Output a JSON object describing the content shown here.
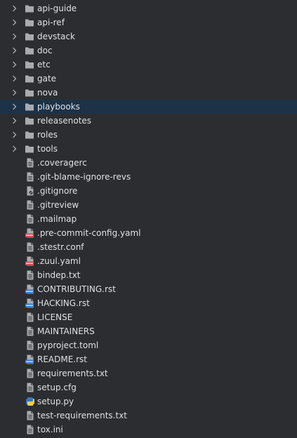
{
  "colors": {
    "background": "#2b2d30",
    "selection": "#1d3247",
    "text": "#dfe1e5",
    "icon": "#a9abaf",
    "yaml_badge": "#c94f4f",
    "rst_badge": "#3c7ac2",
    "python_blue": "#3b76b3",
    "python_yellow": "#f2cd4a"
  },
  "tree": {
    "folders": [
      {
        "label": "api-guide",
        "icon": "folder-icon",
        "selected": false
      },
      {
        "label": "api-ref",
        "icon": "folder-icon",
        "selected": false
      },
      {
        "label": "devstack",
        "icon": "folder-icon",
        "selected": false
      },
      {
        "label": "doc",
        "icon": "folder-icon",
        "selected": false
      },
      {
        "label": "etc",
        "icon": "folder-icon",
        "selected": false
      },
      {
        "label": "gate",
        "icon": "folder-icon",
        "selected": false
      },
      {
        "label": "nova",
        "icon": "folder-icon",
        "selected": false
      },
      {
        "label": "playbooks",
        "icon": "folder-icon",
        "selected": true
      },
      {
        "label": "releasenotes",
        "icon": "folder-icon",
        "selected": false
      },
      {
        "label": "roles",
        "icon": "folder-icon",
        "selected": false
      },
      {
        "label": "tools",
        "icon": "folder-icon",
        "selected": false
      }
    ],
    "files": [
      {
        "label": ".coveragerc",
        "icon": "text-file-icon"
      },
      {
        "label": ".git-blame-ignore-revs",
        "icon": "text-file-icon"
      },
      {
        "label": ".gitignore",
        "icon": "ignore-file-icon"
      },
      {
        "label": ".gitreview",
        "icon": "text-file-icon"
      },
      {
        "label": ".mailmap",
        "icon": "text-file-icon"
      },
      {
        "label": ".pre-commit-config.yaml",
        "icon": "yaml-file-icon",
        "badge": "YML"
      },
      {
        "label": ".stestr.conf",
        "icon": "text-file-icon"
      },
      {
        "label": ".zuul.yaml",
        "icon": "yaml-file-icon",
        "badge": "YML"
      },
      {
        "label": "bindep.txt",
        "icon": "text-file-icon"
      },
      {
        "label": "CONTRIBUTING.rst",
        "icon": "rst-file-icon",
        "badge": "RST"
      },
      {
        "label": "HACKING.rst",
        "icon": "rst-file-icon",
        "badge": "RST"
      },
      {
        "label": "LICENSE",
        "icon": "text-file-icon"
      },
      {
        "label": "MAINTAINERS",
        "icon": "text-file-icon"
      },
      {
        "label": "pyproject.toml",
        "icon": "text-file-icon"
      },
      {
        "label": "README.rst",
        "icon": "rst-file-icon",
        "badge": "RST"
      },
      {
        "label": "requirements.txt",
        "icon": "text-file-icon"
      },
      {
        "label": "setup.cfg",
        "icon": "text-file-icon"
      },
      {
        "label": "setup.py",
        "icon": "python-file-icon"
      },
      {
        "label": "test-requirements.txt",
        "icon": "text-file-icon"
      },
      {
        "label": "tox.ini",
        "icon": "text-file-icon"
      }
    ]
  }
}
